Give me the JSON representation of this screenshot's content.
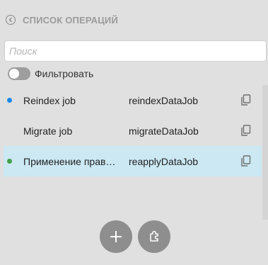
{
  "header": {
    "title": "СПИСОК ОПЕРАЦИЙ"
  },
  "search": {
    "placeholder": "Поиск",
    "value": ""
  },
  "filter": {
    "label": "Фильтровать",
    "enabled": false
  },
  "operations": [
    {
      "name": "Reindex job",
      "code": "reindexDataJob",
      "status_color": "#1e88e5",
      "selected": false
    },
    {
      "name": "Migrate job",
      "code": "migrateDataJob",
      "status_color": null,
      "selected": false
    },
    {
      "name": "Применение прав…",
      "code": "reapplyDataJob",
      "status_color": "#43a047",
      "selected": true
    }
  ],
  "icons": {
    "back": "back-circle-icon",
    "copy": "copy-icon",
    "add": "plus-icon",
    "plugin": "puzzle-icon"
  },
  "colors": {
    "background": "#e0e0e0",
    "selected_row": "#cbe8f3",
    "fab": "#8e8e8e"
  }
}
